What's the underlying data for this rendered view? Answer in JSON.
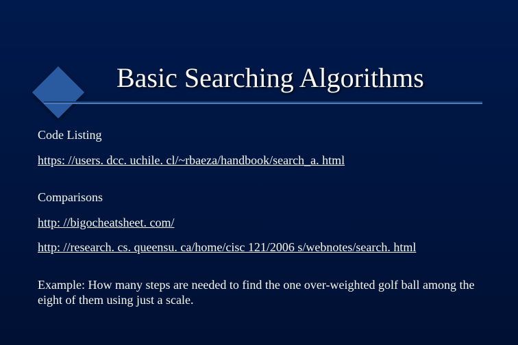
{
  "title": "Basic Searching Algorithms",
  "sections": {
    "code_heading": "Code Listing",
    "code_link1": "https: //users. dcc. uchile. cl/~rbaeza/handbook/search_a. html",
    "comp_heading": "Comparisons",
    "comp_link1": "http: //bigocheatsheet. com/",
    "comp_link2": "http: //research. cs. queensu. ca/home/cisc 121/2006 s/webnotes/search. html",
    "example": "Example: How many steps are needed to find the one over-weighted golf ball among the eight of them using just a scale."
  }
}
